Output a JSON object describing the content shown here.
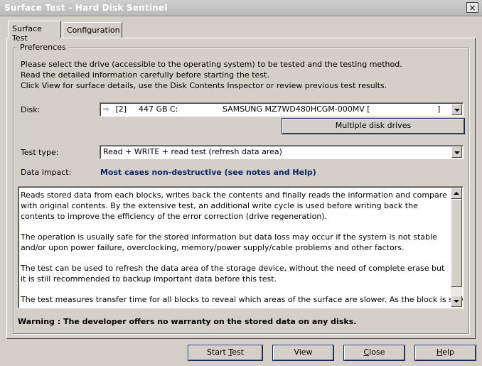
{
  "window": {
    "title": "Surface Test - Hard Disk Sentinel",
    "close_glyph": "×"
  },
  "tabs": [
    {
      "label": "Surface Test",
      "active": true
    },
    {
      "label": "Configuration",
      "active": false
    }
  ],
  "preferences": {
    "legend": "Preferences",
    "intro": [
      "Please select the drive (accessible to the operating system) to be tested and the testing method.",
      "Read the detailed information carefully before starting the test.",
      "Click View for surface details, use the Disk Contents Inspector or review previous test results."
    ]
  },
  "disk": {
    "label": "Disk:",
    "index": "[2]",
    "size": "447 GB",
    "letter": "C:",
    "model": "SAMSUNG MZ7WD480HCGM-000MV [",
    "suffix": "]",
    "icon": "hdd-icon"
  },
  "multiple_button": "Multiple disk drives",
  "test_type": {
    "label": "Test type:",
    "value": "Read + WRITE + read test (refresh data area)"
  },
  "data_impact": {
    "label": "Data impact:",
    "value": "Most cases non-destructive (see notes and Help)",
    "color": "#0a246a"
  },
  "description": [
    "Reads stored data from each blocks, writes back the contents and finally reads the information and compare with original contents. By the extensive test, an additional write cycle is used before writing back the contents to improve the efficiency of the error correction (drive regeneration).",
    "The operation is usually safe for the stored information but data loss may occur if the system is not stable and/or upon power failure, overclocking, memory/power supply/cable problems and other factors.",
    "The test can be used to refresh the data area of the storage device, without the need of complete erase but it is still recommended to backup important data before this test.",
    "The test measures transfer time for all blocks to reveal which areas of the surface are slower. As the block is slower,"
  ],
  "warning": "Warning : The developer offers no warranty on the stored data on any disks.",
  "buttons": {
    "start_test": {
      "pre": "Start ",
      "key": "T",
      "post": "est"
    },
    "view": "View",
    "close": {
      "key": "C",
      "post": "lose"
    },
    "help": {
      "key": "H",
      "post": "elp"
    }
  }
}
